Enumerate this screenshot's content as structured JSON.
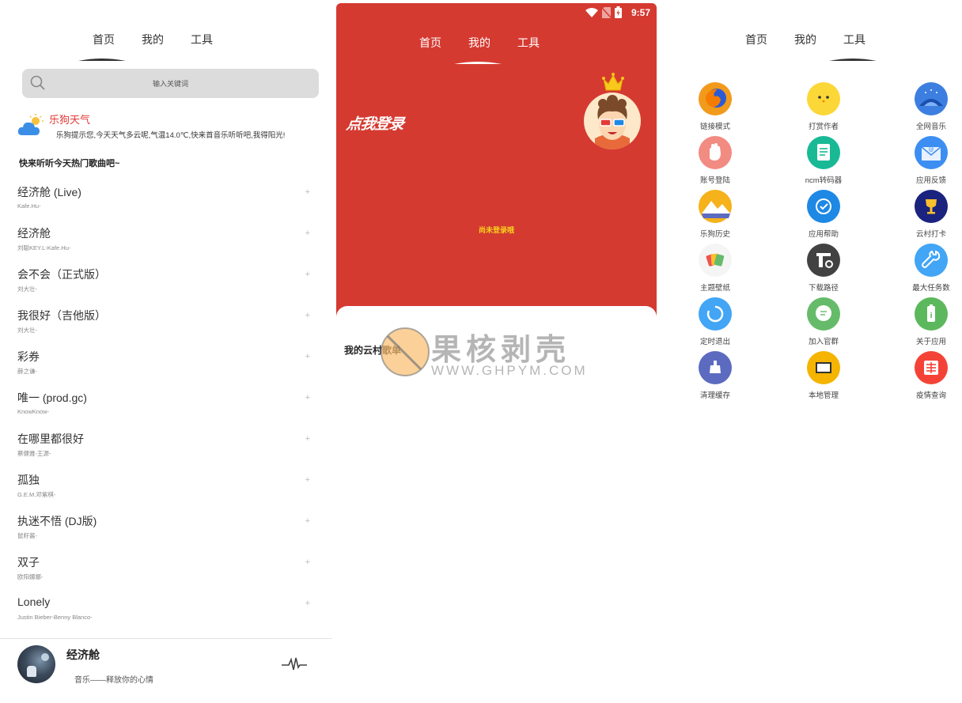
{
  "panel_home": {
    "tabs": [
      "首页",
      "我的",
      "工具"
    ],
    "search": {
      "placeholder": "输入关键词"
    },
    "weather": {
      "title": "乐狗天气",
      "text": "乐狗提示您,今天天气多云呢,气温14.0℃,快来首音乐听听吧,我得阳光!"
    },
    "hot_title": "快来听听今天热门歌曲吧~",
    "songs": [
      {
        "name": "经济舱 (Live)",
        "artist": "Kafe.Hu-"
      },
      {
        "name": "经济舱",
        "artist": "刘聪KEY.L-Kafe.Hu-"
      },
      {
        "name": "会不会（正式版）",
        "artist": "刘大壮-"
      },
      {
        "name": "我很好（吉他版）",
        "artist": "刘大壮-"
      },
      {
        "name": "彩券",
        "artist": "薛之谦-"
      },
      {
        "name": "唯一 (prod.gc)",
        "artist": "KnowKnow-"
      },
      {
        "name": "在哪里都很好",
        "artist": "蔡健雅-王源-"
      },
      {
        "name": "孤独",
        "artist": "G.E.M.邓紫棋-"
      },
      {
        "name": "执迷不悟 (DJ版)",
        "artist": "鼠籽酱-"
      },
      {
        "name": "双子",
        "artist": "欧阳娜娜-"
      },
      {
        "name": "Lonely",
        "artist": "Justin Bieber-Benny Blanco-"
      }
    ],
    "add_symbol": "+",
    "player": {
      "title": "经济舱",
      "subtitle": "音乐——释放你的心情"
    }
  },
  "panel_mine": {
    "status": {
      "time": "9:57"
    },
    "tabs": [
      "首页",
      "我的",
      "工具"
    ],
    "login_text": "点我登录",
    "not_logged_text": "尚未登录哦",
    "my_playlist_title": "我的云村歌单",
    "watermark": {
      "text": "果核剥壳",
      "url": "WWW.GHPYM.COM"
    },
    "colors": {
      "red": "#d53a31"
    }
  },
  "panel_tools": {
    "tabs": [
      "首页",
      "我的",
      "工具"
    ],
    "tools": [
      {
        "label": "链接模式",
        "icon": "firefox-icon",
        "color": "#f19a1c"
      },
      {
        "label": "打赏作者",
        "icon": "chick-icon",
        "color": "#fcd738"
      },
      {
        "label": "全网音乐",
        "icon": "sky-icon",
        "color": "#3d7fe0"
      },
      {
        "label": "账号登陆",
        "icon": "hand-icon",
        "color": "#f28b82"
      },
      {
        "label": "ncm转码器",
        "icon": "document-icon",
        "color": "#19b996"
      },
      {
        "label": "应用反馈",
        "icon": "mail-icon",
        "color": "#3c8ef3"
      },
      {
        "label": "乐狗历史",
        "icon": "mountain-icon",
        "color": "#f6b21b"
      },
      {
        "label": "应用帮助",
        "icon": "help-icon",
        "color": "#1e88e5"
      },
      {
        "label": "云村打卡",
        "icon": "trophy-icon",
        "color": "#1a237e"
      },
      {
        "label": "主题壁纸",
        "icon": "cards-icon",
        "color": "#f5f5f5"
      },
      {
        "label": "下载路径",
        "icon": "path-icon",
        "color": "#424242"
      },
      {
        "label": "最大任务数",
        "icon": "wrench-icon",
        "color": "#42a5f5"
      },
      {
        "label": "定时退出",
        "icon": "timer-icon",
        "color": "#42a5f5"
      },
      {
        "label": "加入官群",
        "icon": "chat-icon",
        "color": "#66bb6a"
      },
      {
        "label": "关于应用",
        "icon": "info-icon",
        "color": "#5cb85c"
      },
      {
        "label": "清理缓存",
        "icon": "cleaner-icon",
        "color": "#5c6bc0"
      },
      {
        "label": "本地管理",
        "icon": "folder-icon",
        "color": "#f4b400"
      },
      {
        "label": "疫情查询",
        "icon": "report-icon",
        "color": "#f44336"
      }
    ]
  }
}
